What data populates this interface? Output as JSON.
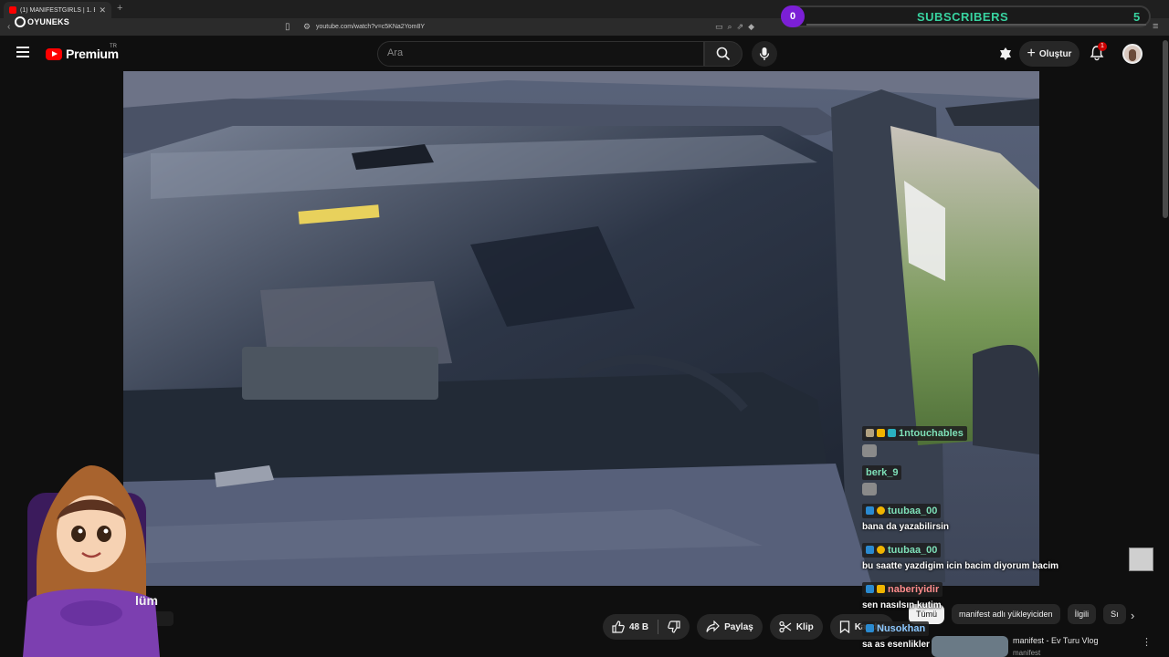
{
  "browser": {
    "tab_title": "(1) MANIFESTGIRLS | 1. Bölüm -",
    "url": "youtube.com/watch?v=c5KNa2Yom8Y"
  },
  "overlay": {
    "logo_text": "OYUNEKS",
    "subs_badge": "0",
    "subs_label": "SUBSCRIBERS",
    "subs_count": "5"
  },
  "header": {
    "brand": "Premium",
    "region": "TR",
    "search_placeholder": "Ara",
    "create_label": "Oluştur",
    "notification_count": "1"
  },
  "video": {
    "title_fragment": "lüm",
    "likes": "48 B",
    "share_label": "Paylaş",
    "clip_label": "Klip",
    "save_label": "Kaydet"
  },
  "recommendations": {
    "chips": [
      "Tümü",
      "manifest adlı yükleyiciden",
      "İlgili",
      "Sı"
    ],
    "first_title": "manifest - Ev Turu Vlog",
    "first_channel": "manifest"
  },
  "chat": {
    "messages": [
      {
        "user": "1ntouchables",
        "text": "",
        "color": "#7ee0b8",
        "emote": true
      },
      {
        "user": "berk_9",
        "text": "",
        "color": "#7ee0b8",
        "emote": true
      },
      {
        "user": "tuubaa_00",
        "text": "bana da yazabilirsin",
        "color": "#7ee0b8",
        "emote": false
      },
      {
        "user": "tuubaa_00",
        "text": "bu saatte yazdigim icin bacim diyorum bacim",
        "color": "#7ee0b8",
        "emote": false
      },
      {
        "user": "naberiyidir",
        "text": "sen nasılsın kutim",
        "color": "#ff8c8c",
        "emote": false
      },
      {
        "user": "Nusokhan",
        "text": "sa as esenlikler",
        "color": "#8cc8ff",
        "emote": false
      }
    ]
  },
  "colors": {
    "accent_red": "#ff0000",
    "subs_green": "#38d3a0",
    "subs_purple": "#7b1fd6"
  }
}
